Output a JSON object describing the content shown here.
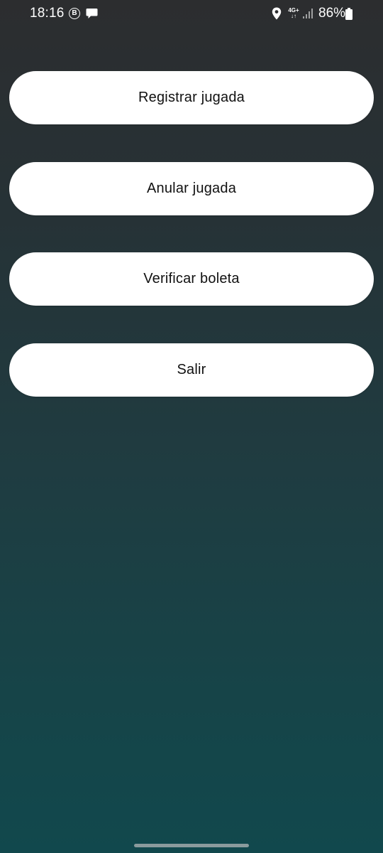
{
  "status_bar": {
    "time": "18:16",
    "b_badge": "B",
    "network_type": "4G+",
    "network_arrows": "↓↑",
    "battery_percent": "86%",
    "icons": [
      "b-badge-icon",
      "chat-icon",
      "location-icon",
      "signal-icon",
      "battery-icon"
    ]
  },
  "menu": {
    "buttons": [
      {
        "label": "Registrar jugada"
      },
      {
        "label": "Anular jugada"
      },
      {
        "label": "Verificar boleta"
      },
      {
        "label": "Salir"
      }
    ]
  },
  "colors": {
    "background_top": "#2c2d2f",
    "background_bottom": "#11484d",
    "button_bg": "#ffffff",
    "button_text": "#111111"
  }
}
